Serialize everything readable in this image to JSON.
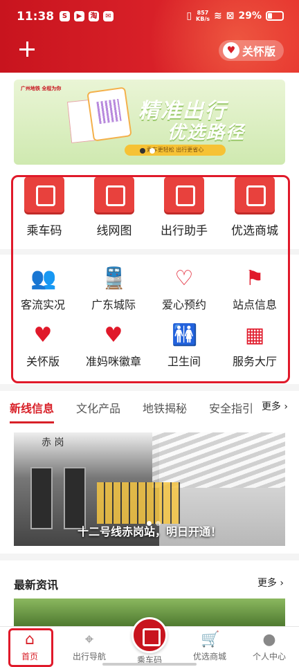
{
  "status_bar": {
    "time": "11:38",
    "net_speed": "857\nKB/s",
    "battery": "29%"
  },
  "header": {
    "care_label": "关怀版"
  },
  "banner": {
    "logo": "广州地铁 全程为你",
    "line1": "精准出行",
    "line2": "优选路径",
    "strip": "乘车更轻松 出行更省心"
  },
  "tools": [
    "乘车码",
    "线网图",
    "出行助手",
    "优选商城"
  ],
  "services": [
    {
      "label": "客流实况",
      "icon": "people-icon"
    },
    {
      "label": "广东城际",
      "icon": "train-icon"
    },
    {
      "label": "爱心预约",
      "icon": "heart-icon"
    },
    {
      "label": "站点信息",
      "icon": "flag-icon"
    },
    {
      "label": "关怀版",
      "icon": "handshake-heart-icon"
    },
    {
      "label": "准妈咪徽章",
      "icon": "mother-badge-icon"
    },
    {
      "label": "卫生间",
      "icon": "restroom-icon"
    },
    {
      "label": "服务大厅",
      "icon": "service-hall-icon"
    }
  ],
  "tabs": [
    "新线信息",
    "文化产品",
    "地铁揭秘",
    "安全指引"
  ],
  "more_label": "更多",
  "news": {
    "station_sign": "赤 岗",
    "caption": "十二号线赤岗站，明日开通！"
  },
  "latest": {
    "title": "最新资讯",
    "more": "更多"
  },
  "nav": {
    "home": "首页",
    "navigation": "出行导航",
    "scan": "乘车码",
    "mall": "优选商城",
    "profile": "个人中心"
  },
  "colors": {
    "brand": "#d82028",
    "highlight": "#e0192a"
  }
}
